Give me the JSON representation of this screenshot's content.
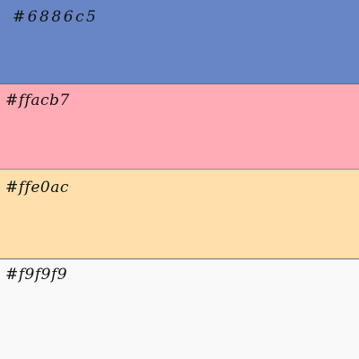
{
  "swatches": [
    {
      "label": "#6886c5",
      "color": "#6886c5"
    },
    {
      "label": "#ffacb7",
      "color": "#ffacb7"
    },
    {
      "label": "#ffe0ac",
      "color": "#ffe0ac"
    },
    {
      "label": "#f9f9f9",
      "color": "#f9f9f9"
    }
  ]
}
